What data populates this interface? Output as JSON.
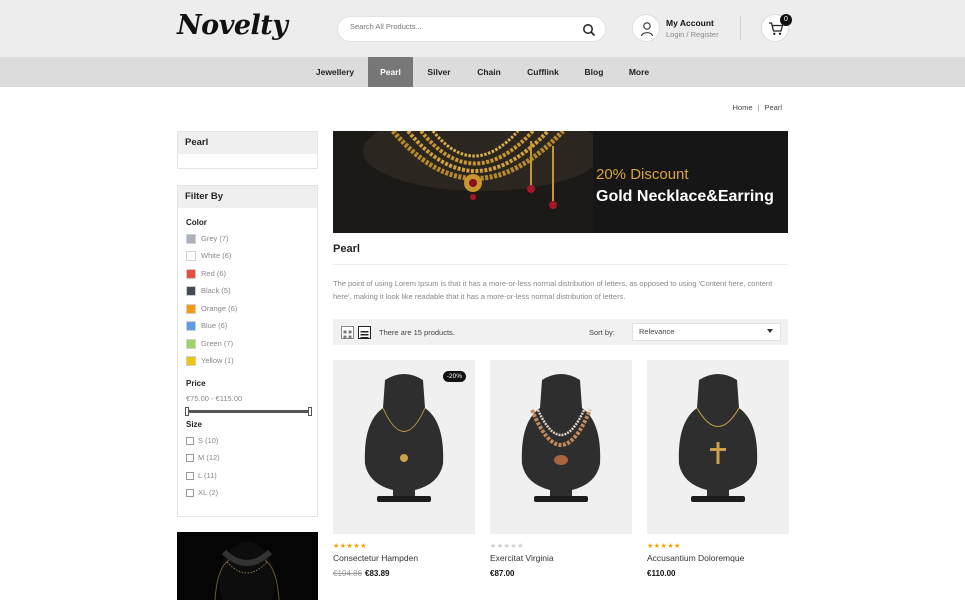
{
  "header": {
    "logo": "Novelty",
    "search_placeholder": "Search All Products...",
    "account_title": "My Account",
    "account_login": "Login",
    "account_sep": "/",
    "account_register": "Register",
    "cart_count": "0"
  },
  "nav": {
    "items": [
      "Jewellery",
      "Pearl",
      "Silver",
      "Chain",
      "Cufflink",
      "Blog",
      "More"
    ],
    "active": "Pearl"
  },
  "breadcrumb": {
    "home": "Home",
    "sep": "|",
    "current": "Pearl"
  },
  "sidebar": {
    "category_title": "Pearl",
    "filter_title": "Filter By",
    "color_title": "Color",
    "colors": [
      {
        "label": "Grey (7)",
        "hex": "#aab2bd"
      },
      {
        "label": "White (6)",
        "hex": "#ffffff"
      },
      {
        "label": "Red (6)",
        "hex": "#e84c3d"
      },
      {
        "label": "Black (5)",
        "hex": "#434a54"
      },
      {
        "label": "Orange (6)",
        "hex": "#f39c11"
      },
      {
        "label": "Blue (6)",
        "hex": "#5d9cec"
      },
      {
        "label": "Green (7)",
        "hex": "#a0d468"
      },
      {
        "label": "Yellow (1)",
        "hex": "#f1c40f"
      }
    ],
    "price_title": "Price",
    "price_range": "€75.00 - €115.00",
    "size_title": "Size",
    "sizes": [
      "S (10)",
      "M (12)",
      "L (11)",
      "XL (2)"
    ]
  },
  "banner": {
    "subtitle": "20% Discount",
    "title": "Gold Necklace&Earring"
  },
  "page": {
    "title": "Pearl",
    "description": "The point of using Lorem Ipsum is that it has a more-or-less normal distribution of letters, as opposed to using 'Content here, content here', making it look like readable that it has a more-or-less normal distribution of letters."
  },
  "toolbar": {
    "product_count": "There are 15 products.",
    "sort_label": "Sort by:",
    "sort_value": "Relevance"
  },
  "products": [
    {
      "name": "Consectetur Hampden",
      "rating": 5,
      "badge": "-20%",
      "old_price": "€104.86",
      "price": "€83.89"
    },
    {
      "name": "Exercitat Virginia",
      "rating": 0,
      "badge": "",
      "old_price": "",
      "price": "€87.00"
    },
    {
      "name": "Accusantium Doloremque",
      "rating": 5,
      "badge": "",
      "old_price": "",
      "price": "€110.00"
    }
  ],
  "colors": {
    "accent": "#777777",
    "header_bg": "#ededed",
    "nav_bg": "#dcdcdc",
    "banner_gold": "#d9a441"
  }
}
